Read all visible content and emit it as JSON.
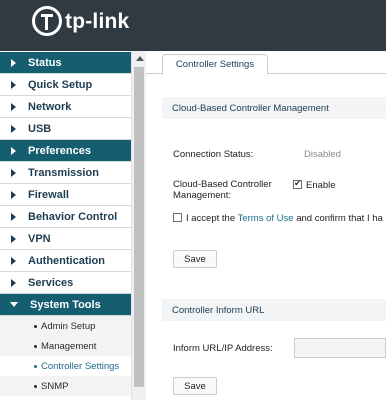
{
  "header": {
    "logo_text": "tp-link"
  },
  "sidebar": {
    "items": [
      {
        "label": "Status"
      },
      {
        "label": "Quick Setup"
      },
      {
        "label": "Network"
      },
      {
        "label": "USB"
      },
      {
        "label": "Preferences"
      },
      {
        "label": "Transmission"
      },
      {
        "label": "Firewall"
      },
      {
        "label": "Behavior Control"
      },
      {
        "label": "VPN"
      },
      {
        "label": "Authentication"
      },
      {
        "label": "Services"
      },
      {
        "label": "System Tools"
      }
    ],
    "subitems": [
      {
        "label": "Admin Setup"
      },
      {
        "label": "Management"
      },
      {
        "label": "Controller Settings"
      },
      {
        "label": "SNMP"
      }
    ]
  },
  "main": {
    "tab_label": "Controller Settings",
    "cloud": {
      "section_title": "Cloud-Based Controller Management",
      "connection_label": "Connection Status:",
      "connection_value": "Disabled",
      "management_label_1": "Cloud-Based Controller",
      "management_label_2": "Management:",
      "enable_label": "Enable",
      "accept_prefix": "I accept the ",
      "terms_link": "Terms of Use",
      "accept_suffix": " and confirm that I ha",
      "save_label": "Save"
    },
    "inform": {
      "section_title": "Controller Inform URL",
      "url_label": "Inform URL/IP Address:",
      "url_value": "",
      "save_label": "Save"
    }
  },
  "colors": {
    "header_bg": "#2f3a42",
    "nav_active_bg": "#145e6f",
    "link": "#1c6f8c"
  }
}
